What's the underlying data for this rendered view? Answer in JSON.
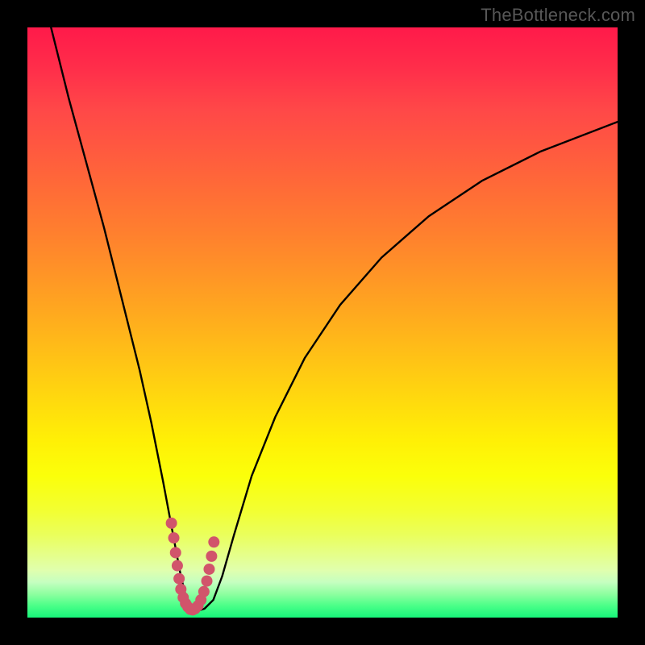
{
  "watermark": "TheBottleneck.com",
  "chart_data": {
    "type": "line",
    "title": "",
    "xlabel": "",
    "ylabel": "",
    "xlim": [
      0,
      100
    ],
    "ylim": [
      0,
      100
    ],
    "grid": false,
    "legend": false,
    "series": [
      {
        "name": "curve",
        "color": "#000000",
        "x": [
          4,
          7,
          10,
          13,
          16,
          19,
          21,
          23,
          24.5,
          26,
          27,
          28,
          29,
          30,
          31.5,
          33,
          35,
          38,
          42,
          47,
          53,
          60,
          68,
          77,
          87,
          100
        ],
        "y": [
          100,
          88,
          77,
          66,
          54,
          42,
          33,
          23,
          15,
          7,
          3,
          1.4,
          1.2,
          1.5,
          3,
          7,
          14,
          24,
          34,
          44,
          53,
          61,
          68,
          74,
          79,
          84
        ]
      },
      {
        "name": "trough-markers",
        "color": "#d1546b",
        "type": "scatter",
        "x": [
          24.4,
          24.8,
          25.1,
          25.4,
          25.7,
          26.0,
          26.4,
          26.8,
          27.2,
          27.6,
          28.0,
          28.4,
          28.9,
          29.4,
          29.9,
          30.4,
          30.8,
          31.2,
          31.6
        ],
        "y": [
          16.0,
          13.5,
          11.0,
          8.8,
          6.6,
          4.8,
          3.4,
          2.4,
          1.8,
          1.4,
          1.3,
          1.5,
          2.0,
          3.0,
          4.4,
          6.2,
          8.2,
          10.4,
          12.8
        ]
      }
    ]
  }
}
